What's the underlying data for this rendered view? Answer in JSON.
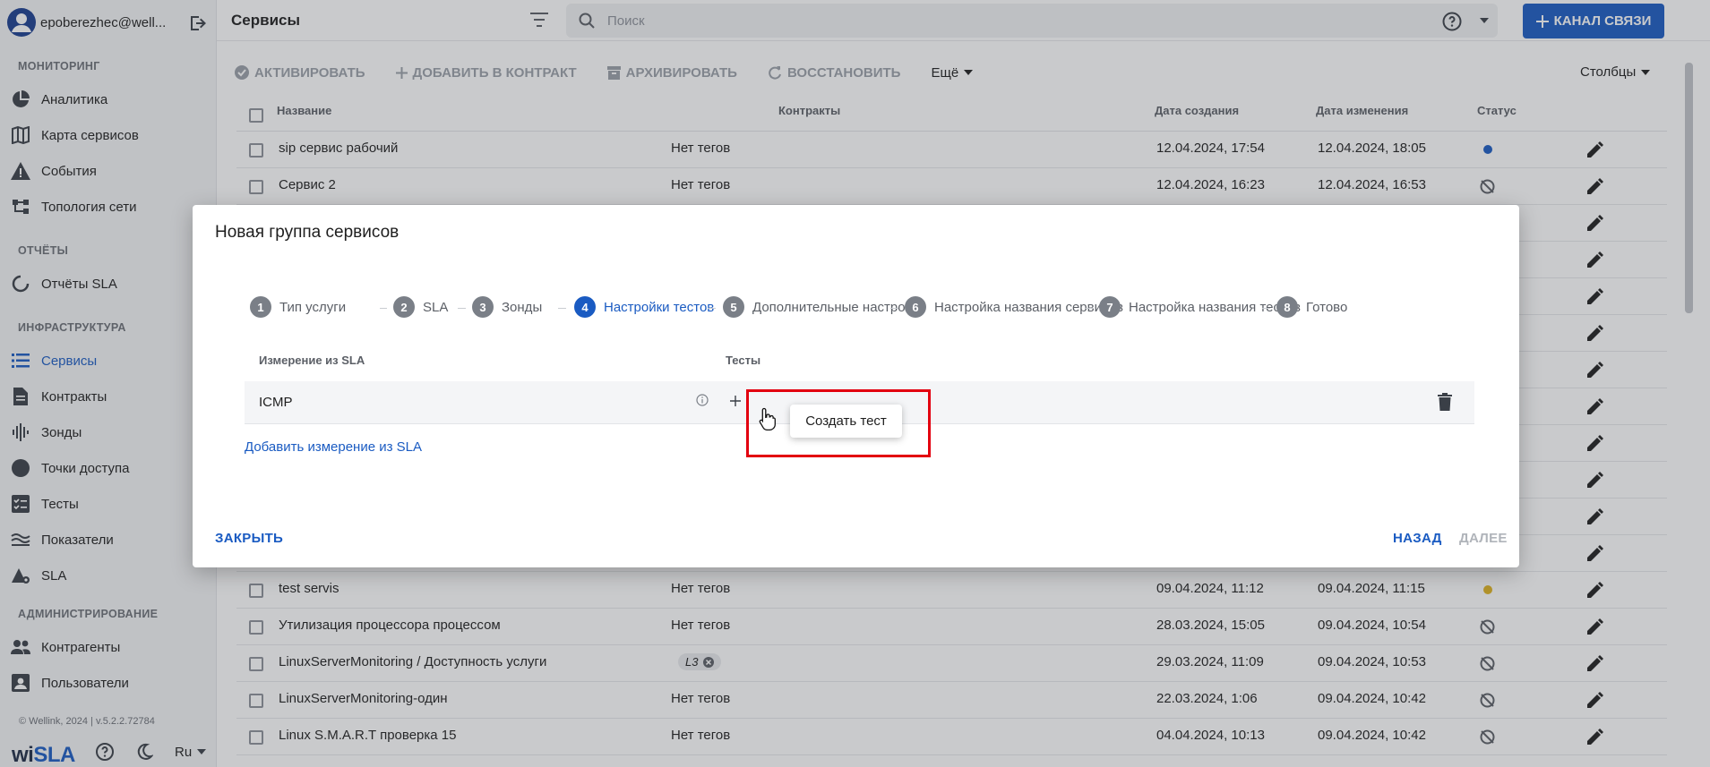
{
  "user": {
    "email": "epoberezhec@well..."
  },
  "sidebar": {
    "sections": [
      {
        "title": "МОНИТОРИНГ",
        "items": [
          {
            "label": "Аналитика",
            "icon": "pie-chart-icon"
          },
          {
            "label": "Карта сервисов",
            "icon": "map-icon"
          },
          {
            "label": "События",
            "icon": "warning-icon"
          },
          {
            "label": "Топология сети",
            "icon": "topology-icon"
          }
        ]
      },
      {
        "title": "ОТЧЁТЫ",
        "items": [
          {
            "label": "Отчёты SLA",
            "icon": "refresh-circle-icon"
          }
        ]
      },
      {
        "title": "ИНФРАСТРУКТУРА",
        "items": [
          {
            "label": "Сервисы",
            "icon": "list-icon"
          },
          {
            "label": "Контракты",
            "icon": "document-icon"
          },
          {
            "label": "Зонды",
            "icon": "signal-icon"
          },
          {
            "label": "Точки доступа",
            "icon": "circle-icon"
          },
          {
            "label": "Тесты",
            "icon": "checklist-icon"
          },
          {
            "label": "Показатели",
            "icon": "waves-icon"
          },
          {
            "label": "SLA",
            "icon": "sla-icon"
          }
        ]
      },
      {
        "title": "АДМИНИСТРИРОВАНИЕ",
        "items": [
          {
            "label": "Контрагенты",
            "icon": "people-icon"
          },
          {
            "label": "Пользователи",
            "icon": "user-card-icon"
          }
        ]
      }
    ],
    "copyright": "© Wellink, 2024 | v.5.2.2.72784",
    "logo": {
      "part1": "wi",
      "part2": "SLA"
    },
    "lang": "Ru"
  },
  "header": {
    "title": "Сервисы",
    "search_placeholder": "Поиск",
    "channel_button": "КАНАЛ СВЯЗИ"
  },
  "toolbar": {
    "activate": "АКТИВИРОВАТЬ",
    "add_to_contract": "ДОБАВИТЬ В КОНТРАКТ",
    "archive": "АРХИВИРОВАТЬ",
    "restore": "ВОССТАНОВИТЬ",
    "more": "Ещё",
    "columns": "Столбцы"
  },
  "table": {
    "columns": [
      "Название",
      "Контракты",
      "Дата создания",
      "Дата изменения",
      "Статус"
    ],
    "rows_top": [
      {
        "name": "sip сервис рабочий",
        "tags": "Нет тегов",
        "created": "12.04.2024, 17:54",
        "modified": "12.04.2024, 18:05",
        "status": "blue"
      },
      {
        "name": "Сервис 2",
        "tags": "Нет тегов",
        "created": "12.04.2024, 16:23",
        "modified": "12.04.2024, 16:53",
        "status": "off"
      }
    ],
    "rows_bottom": [
      {
        "name": "test servis",
        "tags": "Нет тегов",
        "created": "09.04.2024, 11:12",
        "modified": "09.04.2024, 11:15",
        "status": "yellow"
      },
      {
        "name": "Утилизация процессора процессом",
        "tags": "Нет тегов",
        "created": "28.03.2024, 15:05",
        "modified": "09.04.2024, 10:54",
        "status": "off"
      },
      {
        "name": "LinuxServerMonitoring / Доступность услуги",
        "tag_chip": "L3",
        "created": "29.03.2024, 11:09",
        "modified": "09.04.2024, 10:53",
        "status": "off"
      },
      {
        "name": "LinuxServerMonitoring-один",
        "tags": "Нет тегов",
        "created": "22.03.2024, 1:06",
        "modified": "09.04.2024, 10:42",
        "status": "off"
      },
      {
        "name": "Linux S.M.A.R.T проверка 15",
        "tags": "Нет тегов",
        "created": "04.04.2024, 10:13",
        "modified": "09.04.2024, 10:42",
        "status": "off"
      }
    ]
  },
  "dialog": {
    "title": "Новая группа сервисов",
    "steps": [
      {
        "num": "1",
        "label": "Тип услуги"
      },
      {
        "num": "2",
        "label": "SLA"
      },
      {
        "num": "3",
        "label": "Зонды"
      },
      {
        "num": "4",
        "label": "Настройки тестов"
      },
      {
        "num": "5",
        "label": "Дополнительные настройки"
      },
      {
        "num": "6",
        "label": "Настройка названия сервисов"
      },
      {
        "num": "7",
        "label": "Настройка названия тестов"
      },
      {
        "num": "8",
        "label": "Готово"
      }
    ],
    "active_step": 4,
    "col_measure": "Измерение из SLA",
    "col_tests": "Тесты",
    "measure_name": "ICMP",
    "add_measure": "Добавить измерение из SLA",
    "tooltip": "Создать тест",
    "close": "ЗАКРЫТЬ",
    "back": "НАЗАД",
    "next": "ДАЛЕЕ"
  },
  "colors": {
    "accent": "#1a5bc2",
    "highlight": "#e3000f",
    "status_blue": "#1a5bc2",
    "status_yellow": "#e0b320"
  }
}
